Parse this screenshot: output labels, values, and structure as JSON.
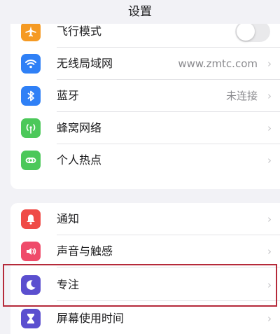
{
  "header": {
    "title": "设置"
  },
  "group1": {
    "airplane": {
      "label": "飞行模式",
      "icon": "airplane-icon",
      "color": "#f59a23",
      "toggle_on": false
    },
    "wifi": {
      "label": "无线局域网",
      "value": "www.zmtc.com",
      "icon": "wifi-icon",
      "color": "#2f80f6"
    },
    "bluetooth": {
      "label": "蓝牙",
      "value": "未连接",
      "icon": "bluetooth-icon",
      "color": "#2f80f6"
    },
    "cellular": {
      "label": "蜂窝网络",
      "icon": "antenna-icon",
      "color": "#4cc85a"
    },
    "hotspot": {
      "label": "个人热点",
      "icon": "hotspot-chain-icon",
      "color": "#4cc85a"
    }
  },
  "group2": {
    "notifications": {
      "label": "通知",
      "icon": "bell-icon",
      "color": "#ef4b47"
    },
    "sounds": {
      "label": "声音与触感",
      "icon": "speaker-icon",
      "color": "#ef4b6a"
    },
    "focus": {
      "label": "专注",
      "icon": "moon-icon",
      "color": "#5b4fcf"
    },
    "screentime": {
      "label": "屏幕使用时间",
      "icon": "hourglass-icon",
      "color": "#5b4fcf"
    }
  },
  "chevron": "›",
  "highlight_color": "#b52a3a"
}
